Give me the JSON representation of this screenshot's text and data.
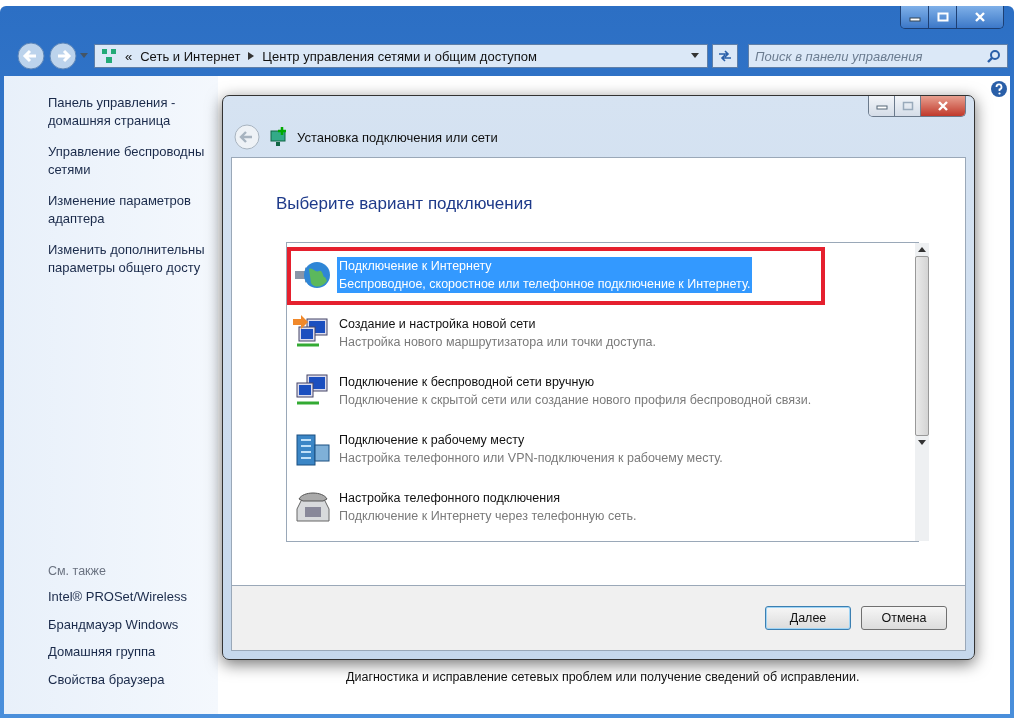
{
  "main_window": {
    "overflow_mark": "«",
    "breadcrumb": [
      "Сеть и Интернет",
      "Центр управления сетями и общим доступом"
    ],
    "search": {
      "placeholder": "Поиск в панели управления"
    }
  },
  "sidebar": {
    "links": [
      {
        "lines": [
          "Панель управления -",
          "домашняя страница"
        ]
      },
      {
        "lines": [
          "Управление беспроводны",
          "сетями"
        ]
      },
      {
        "lines": [
          "Изменение параметров",
          "адаптера"
        ]
      },
      {
        "lines": [
          "Изменить дополнительны",
          "параметры общего досту"
        ]
      }
    ],
    "see_also_title": "См. также",
    "see_also": [
      "Intel® PROSet/Wireless",
      "Брандмауэр Windows",
      "Домашняя группа",
      "Свойства браузера"
    ]
  },
  "background": {
    "description": "Диагностика и исправление сетевых проблем или получение сведений об исправлении."
  },
  "dialog": {
    "title": "Установка подключения или сети",
    "heading": "Выберите вариант подключения",
    "options": [
      {
        "kind": "globe",
        "title": "Подключение к Интернету",
        "description": "Беспроводное, скоростное или телефонное подключение к Интернету.",
        "selected": true,
        "highlighted": true
      },
      {
        "kind": "new-network",
        "title": "Создание и настройка новой сети",
        "description": "Настройка нового маршрутизатора или точки доступа.",
        "selected": false,
        "highlighted": false
      },
      {
        "kind": "wireless",
        "title": "Подключение к беспроводной сети вручную",
        "description": "Подключение к скрытой сети или создание нового профиля беспроводной связи.",
        "selected": false,
        "highlighted": false
      },
      {
        "kind": "workplace",
        "title": "Подключение к рабочему месту",
        "description": "Настройка телефонного или VPN-подключения к рабочему месту.",
        "selected": false,
        "highlighted": false
      },
      {
        "kind": "phone",
        "title": "Настройка телефонного подключения",
        "description": "Подключение к Интернету через телефонную сеть.",
        "selected": false,
        "highlighted": false
      }
    ],
    "buttons": [
      {
        "label": "Далее",
        "default": true
      },
      {
        "label": "Отмена",
        "default": false
      }
    ]
  }
}
